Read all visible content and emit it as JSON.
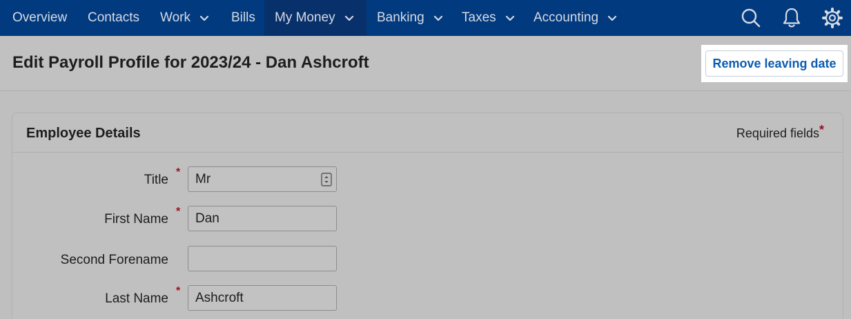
{
  "nav": {
    "items": [
      {
        "label": "Overview",
        "dropdown": false
      },
      {
        "label": "Contacts",
        "dropdown": false
      },
      {
        "label": "Work",
        "dropdown": true
      },
      {
        "label": "Bills",
        "dropdown": false
      },
      {
        "label": "My Money",
        "dropdown": true,
        "active": true
      },
      {
        "label": "Banking",
        "dropdown": true
      },
      {
        "label": "Taxes",
        "dropdown": true
      },
      {
        "label": "Accounting",
        "dropdown": true
      }
    ],
    "icons": [
      "search-icon",
      "bell-icon",
      "gear-icon"
    ]
  },
  "header": {
    "title": "Edit Payroll Profile for 2023/24 - Dan Ashcroft",
    "remove_leaving_date_label": "Remove leaving date"
  },
  "panel": {
    "title": "Employee Details",
    "required_fields_label": "Required fields",
    "required_marker": "*"
  },
  "form": {
    "fields": [
      {
        "label": "Title",
        "value": "Mr",
        "required": true,
        "type": "select"
      },
      {
        "label": "First Name",
        "value": "Dan",
        "required": true,
        "type": "text"
      },
      {
        "label": "Second Forename",
        "value": "",
        "required": false,
        "type": "text"
      },
      {
        "label": "Last Name",
        "value": "Ashcroft",
        "required": true,
        "type": "text"
      }
    ]
  },
  "colors": {
    "nav_background": "#023a80",
    "link_blue": "#0b5cb0",
    "required_red": "#9b1020"
  }
}
